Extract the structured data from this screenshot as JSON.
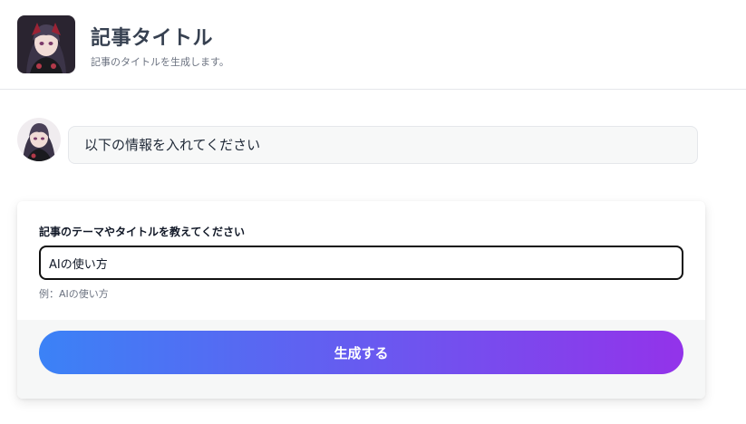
{
  "header": {
    "title": "記事タイトル",
    "description": "記事のタイトルを生成します。",
    "avatar_icon": "anime-girl-avatar-icon"
  },
  "chat": {
    "bot_avatar_icon": "anime-girl-avatar-icon",
    "message": "以下の情報を入れてください"
  },
  "form": {
    "label": "記事のテーマやタイトルを教えてください",
    "input_value": "AIの使い方",
    "help_text": "例：AIの使い方",
    "submit_label": "生成する"
  },
  "colors": {
    "button_gradient_start": "#3b82f6",
    "button_gradient_end": "#9333ea"
  }
}
